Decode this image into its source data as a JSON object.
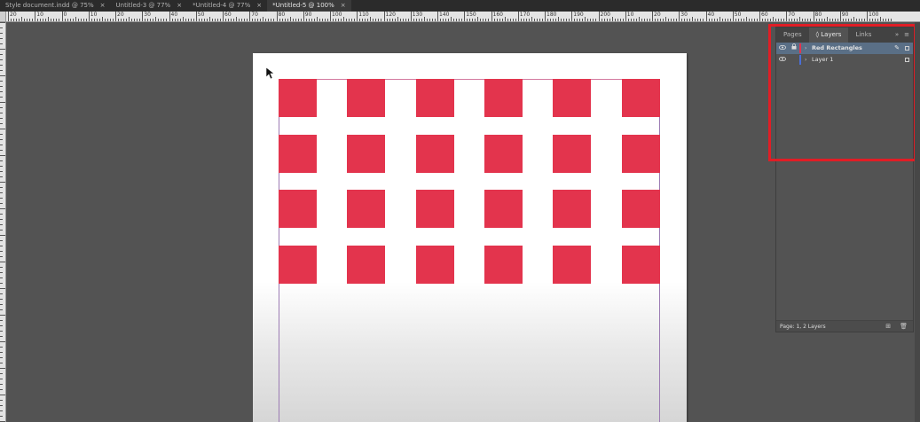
{
  "tabs": [
    {
      "label": "Style document.indd @ 75%",
      "active": false
    },
    {
      "label": "Untitled-3 @ 77%",
      "active": false
    },
    {
      "label": "*Untitled-4 @ 77%",
      "active": false
    },
    {
      "label": "*Untitled-5 @ 100%",
      "active": true
    }
  ],
  "tab_close_glyph": "×",
  "ruler": {
    "h_labels": [
      "20",
      "10",
      "0",
      "10",
      "20",
      "30",
      "40",
      "50",
      "60",
      "70",
      "80",
      "90",
      "100",
      "110",
      "120",
      "130",
      "140",
      "150",
      "160",
      "170",
      "180",
      "190",
      "200",
      "10",
      "20",
      "30",
      "40",
      "50",
      "60",
      "70",
      "80",
      "90",
      "100"
    ]
  },
  "layers_panel": {
    "tabs": [
      {
        "label": "Pages",
        "active": false
      },
      {
        "label": "Layers",
        "active": true
      },
      {
        "label": "Links",
        "active": false
      }
    ],
    "menu_expand": "»",
    "menu_icon": "≡",
    "layers": [
      {
        "name": "Red Rectangles",
        "selected": true,
        "color": "#e3344d",
        "locked": true
      },
      {
        "name": "Layer 1",
        "selected": false,
        "color": "#4a6fd6",
        "locked": false
      }
    ],
    "footer_text": "Page: 1, 2 Layers"
  },
  "colors": {
    "rect_fill": "#e3344d",
    "highlight": "#e11d25",
    "selection": "#5a6f86"
  },
  "rect_grid": {
    "rows": 4,
    "cols": 6
  }
}
